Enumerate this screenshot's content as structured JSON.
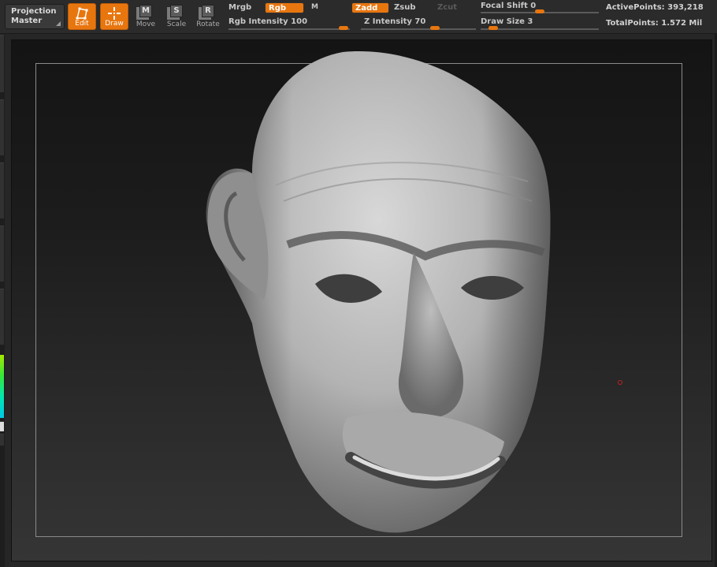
{
  "toolbar": {
    "projection_master": [
      "Projection",
      "Master"
    ],
    "tools": {
      "edit": "Edit",
      "draw": "Draw",
      "move": "Move",
      "scale": "Scale",
      "rotate": "Rotate"
    },
    "tool_letters": {
      "move": "M",
      "scale": "S",
      "rotate": "R"
    },
    "mrgb": "Mrgb",
    "rgb": "Rgb",
    "m": "M",
    "zadd": "Zadd",
    "zsub": "Zsub",
    "zcut": "Zcut",
    "rgb_intensity": "Rgb  Intensity 100",
    "z_intensity": "Z  Intensity 70",
    "focal_shift": "Focal  Shift 0",
    "draw_size": "Draw  Size 3",
    "active_points": "ActivePoints: 393,218",
    "total_points": "TotalPoints: 1.572  Mil",
    "accent_color": "#e8760f"
  }
}
